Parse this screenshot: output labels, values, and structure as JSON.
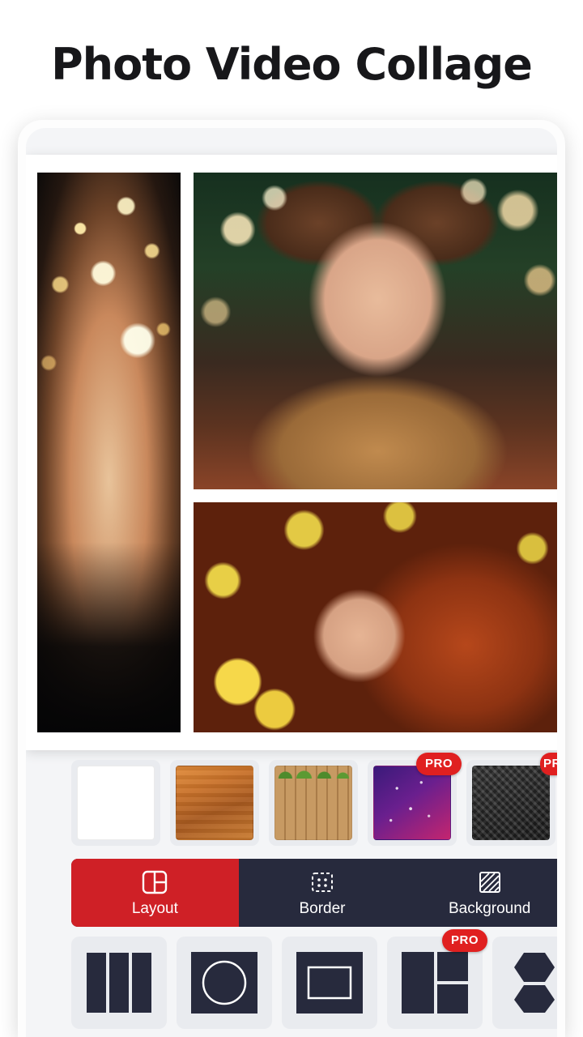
{
  "header": {
    "title": "Photo Video Collage"
  },
  "collage": {
    "photos": [
      {
        "name": "sparkler-girl-photo",
        "alt": "Woman holding sparkler with bokeh lights"
      },
      {
        "name": "bun-hairstyle-girl-photo",
        "alt": "Woman with bun hairstyle and teddy bear"
      },
      {
        "name": "red-hair-girl-photo",
        "alt": "Red haired woman among yellow roses"
      }
    ]
  },
  "backgrounds": {
    "items": [
      {
        "name": "background-white",
        "label": "White",
        "color": "#ffffff",
        "pro": false
      },
      {
        "name": "background-wood-light",
        "label": "Light Wood",
        "color": "#c9722a",
        "pro": false
      },
      {
        "name": "background-fence",
        "label": "Fence",
        "color": "#c79a63",
        "pro": false
      },
      {
        "name": "background-galaxy",
        "label": "Galaxy",
        "color": "#6a1f8e",
        "pro": true
      },
      {
        "name": "background-metal",
        "label": "Metal",
        "color": "#2b2b2b",
        "pro": false
      }
    ],
    "pro_badge_label": "PRO"
  },
  "tabs": {
    "items": [
      {
        "id": "layout",
        "label": "Layout",
        "icon": "layout-icon",
        "active": true
      },
      {
        "id": "border",
        "label": "Border",
        "icon": "border-icon",
        "active": false
      },
      {
        "id": "background",
        "label": "Background",
        "icon": "background-icon",
        "active": false
      }
    ],
    "active_color": "#cf2026",
    "bar_color": "#272a3d"
  },
  "layouts": {
    "items": [
      {
        "name": "layout-three-columns",
        "icon": "three-columns-icon",
        "pro": false
      },
      {
        "name": "layout-circle-center",
        "icon": "circle-center-icon",
        "pro": false
      },
      {
        "name": "layout-frame-center",
        "icon": "frame-center-icon",
        "pro": false
      },
      {
        "name": "layout-split-right",
        "icon": "split-right-icon",
        "pro": true
      },
      {
        "name": "layout-hexagons",
        "icon": "hexagons-icon",
        "pro": true
      }
    ],
    "pro_badge_label": "PRO"
  }
}
